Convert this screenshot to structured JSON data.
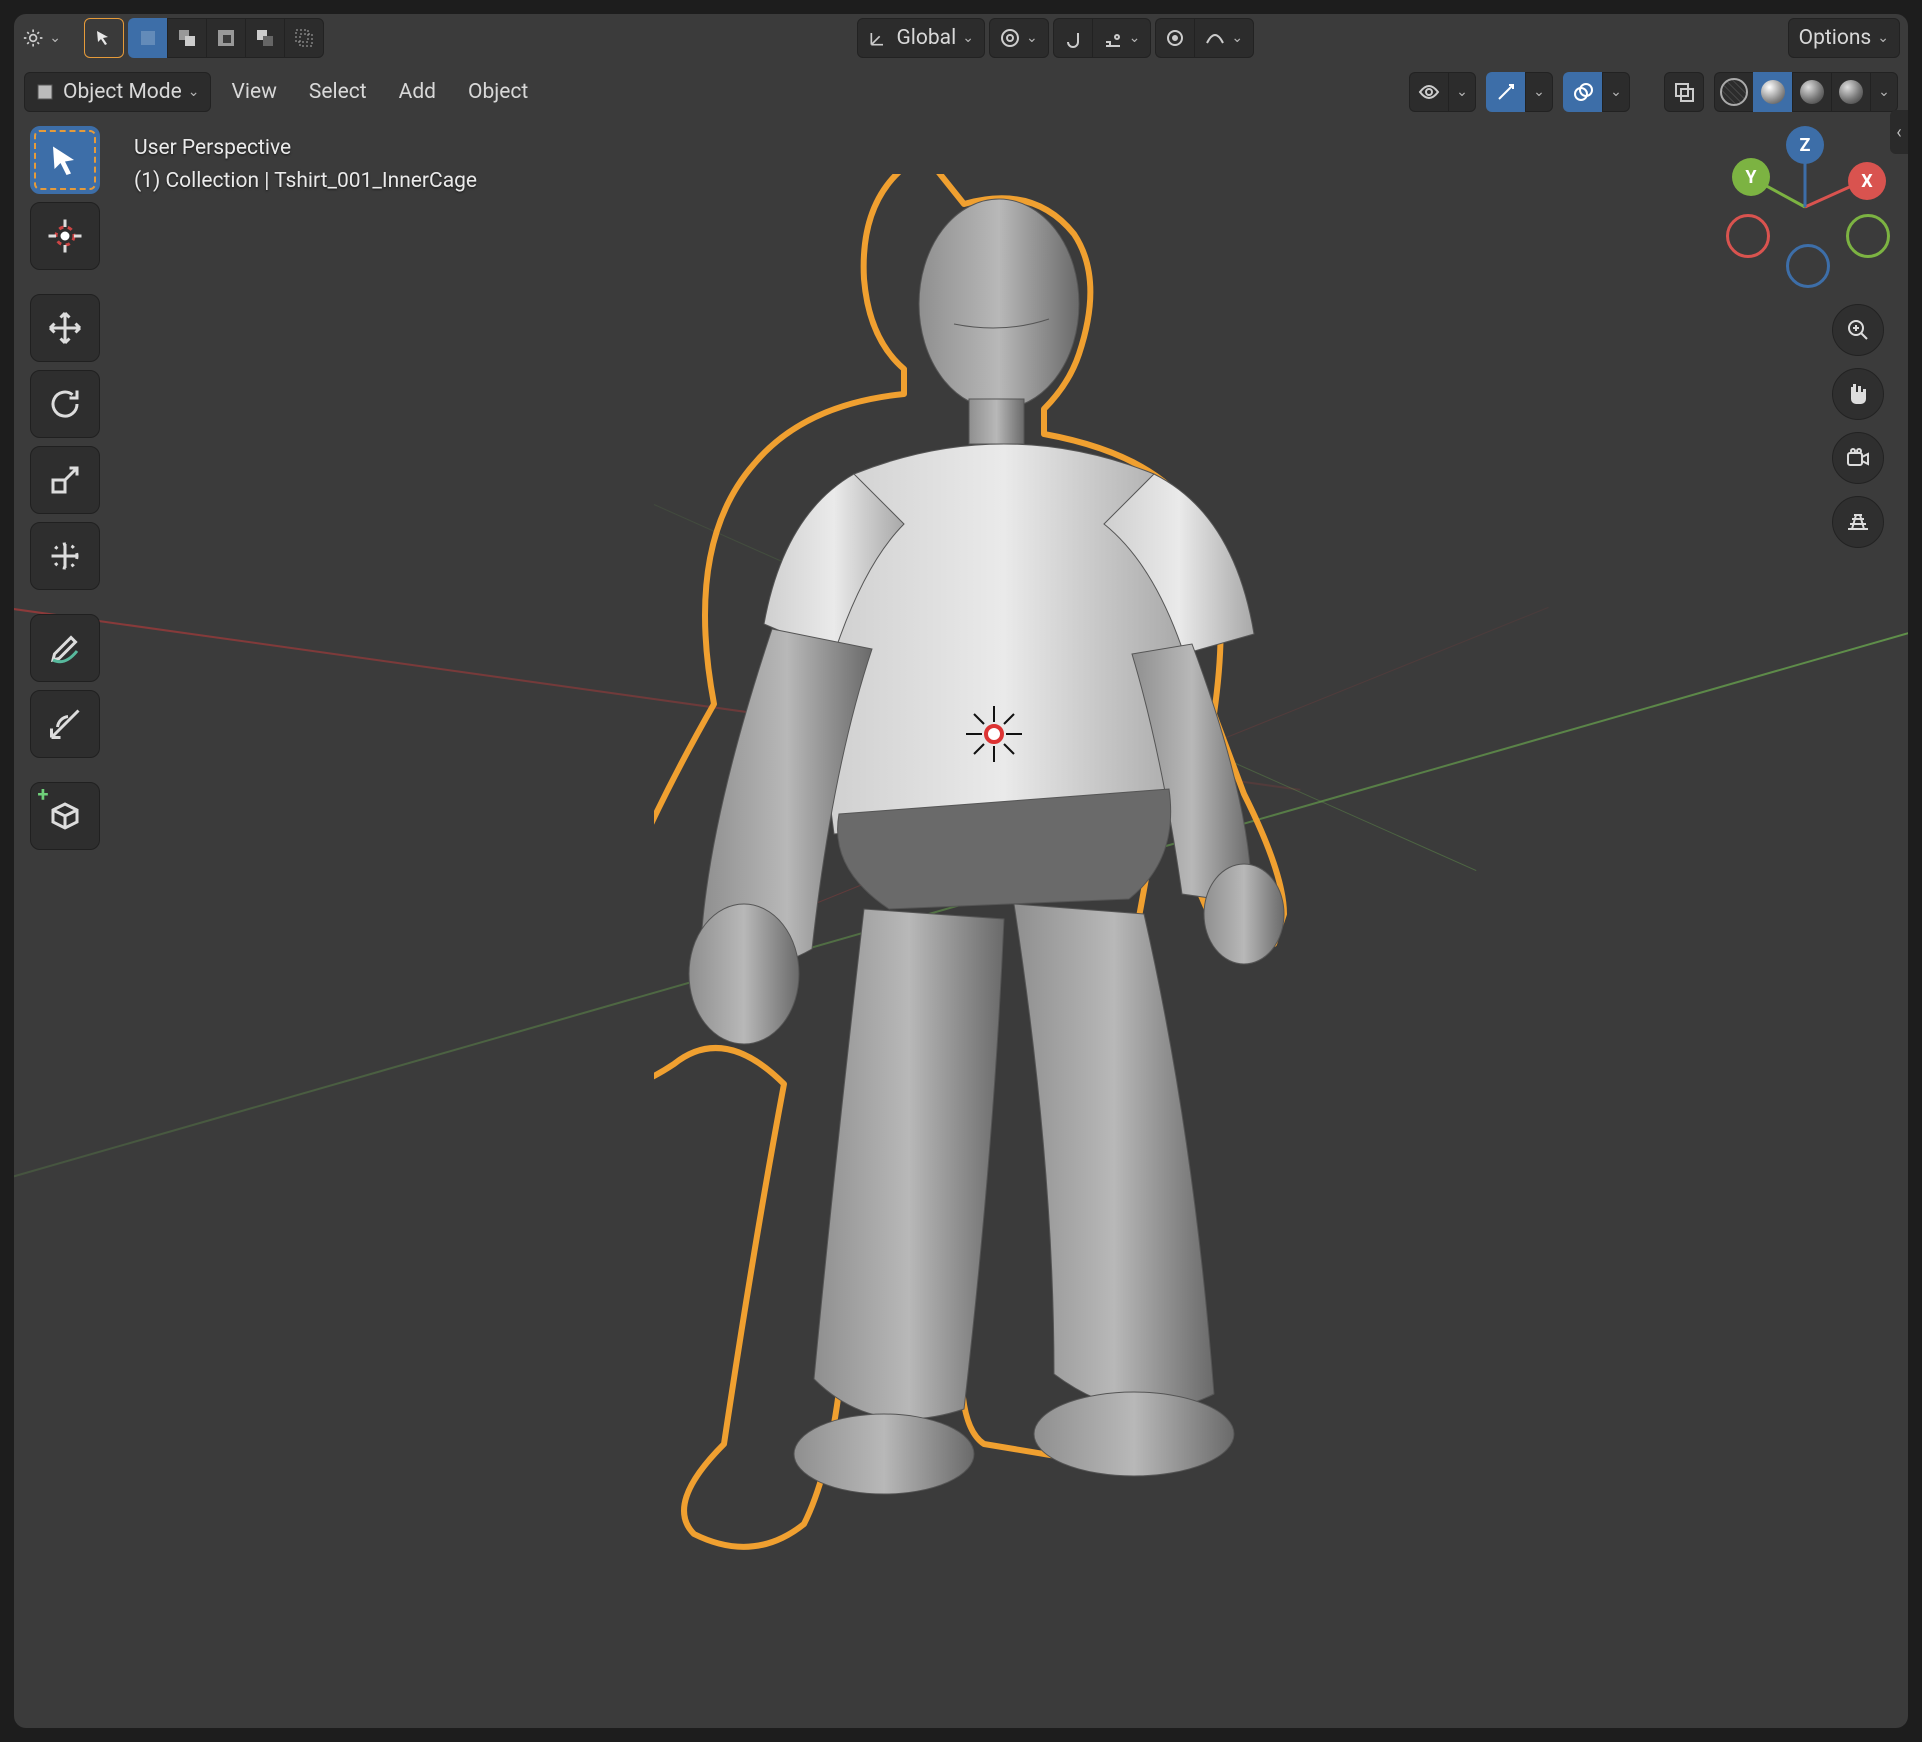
{
  "header": {
    "transform_orientation": "Global",
    "options_label": "Options"
  },
  "header2": {
    "mode_label": "Object Mode",
    "menus": [
      "View",
      "Select",
      "Add",
      "Object"
    ]
  },
  "overlay": {
    "line1": "User Perspective",
    "line2": "(1) Collection | Tshirt_001_InnerCage"
  },
  "tools": [
    {
      "name": "select-box",
      "active": true
    },
    {
      "name": "cursor"
    },
    {
      "name": "move"
    },
    {
      "name": "rotate"
    },
    {
      "name": "scale"
    },
    {
      "name": "transform"
    },
    {
      "name": "annotate"
    },
    {
      "name": "measure"
    },
    {
      "name": "add-cube"
    }
  ],
  "gizmo": {
    "x": "X",
    "y": "Y",
    "z": "Z"
  },
  "right_buttons": [
    "zoom",
    "pan",
    "camera",
    "grid"
  ],
  "colors": {
    "accent": "#3d6ea8",
    "selection_outline": "#f5a623",
    "axis_x": "#d9534f",
    "axis_y": "#7cb342",
    "axis_z": "#3d6ea8"
  }
}
